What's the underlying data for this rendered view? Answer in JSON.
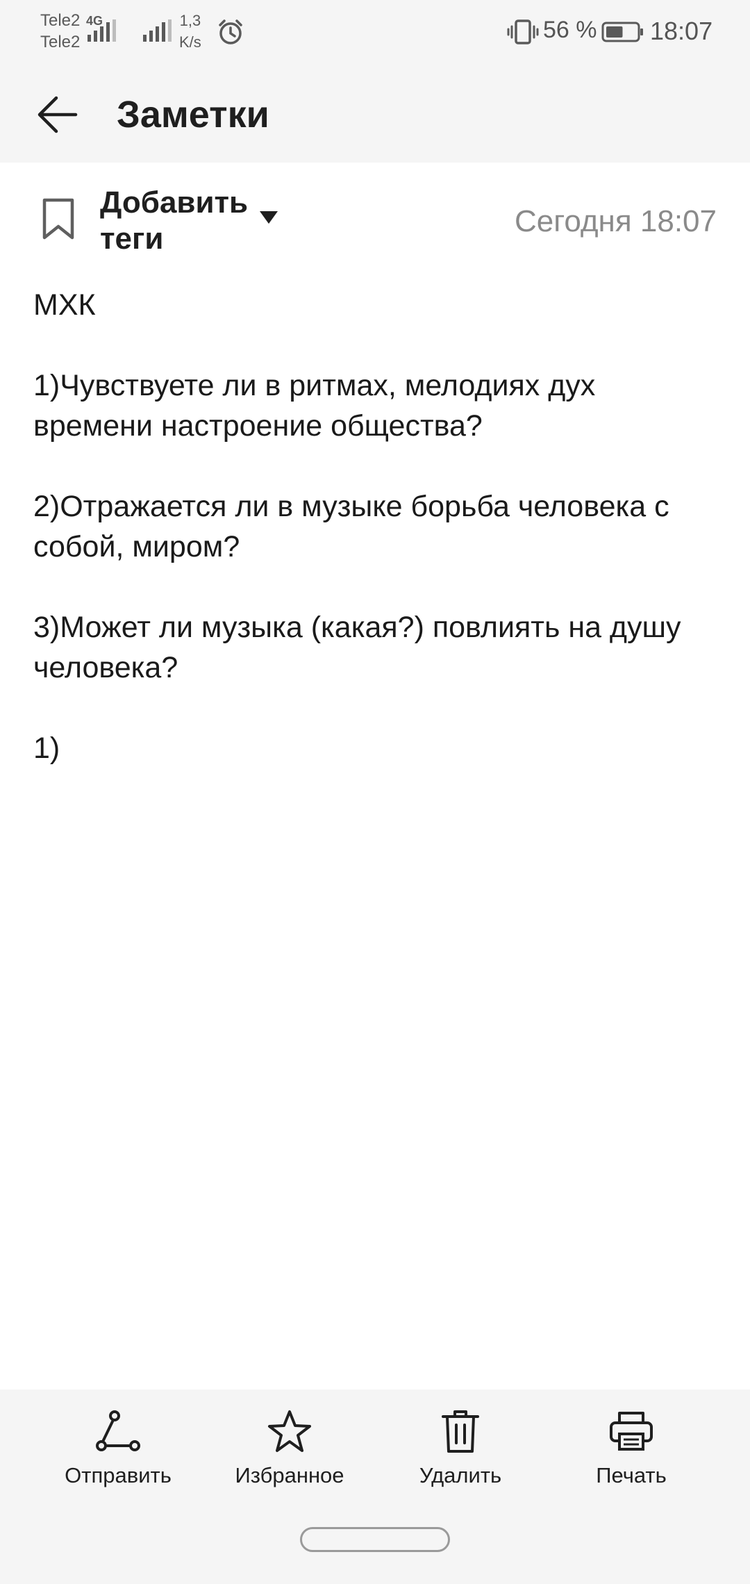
{
  "status_bar": {
    "carrier_1": "Tele2",
    "carrier_2": "Tele2",
    "network_type": "4G",
    "speed_value": "1,3",
    "speed_unit": "K/s",
    "battery_percent": "56 %",
    "time": "18:07",
    "battery_level": 0.56,
    "icons": [
      "signal-icon",
      "alarm-icon",
      "vibrate-icon",
      "battery-icon"
    ]
  },
  "app_bar": {
    "title": "Заметки",
    "back_icon": "arrow-left-icon"
  },
  "tag_row": {
    "label_line1": "Добавить",
    "label_line2": "теги",
    "date": "Сегодня 18:07",
    "icons": [
      "bookmark-icon",
      "dropdown-icon"
    ]
  },
  "note": {
    "title": "МХК",
    "lines": [
      "1)Чувствуете ли в ритмах, мелодиях дух времени настроение общества?",
      "2)Отражается ли в музыке борьба человека с собой, миром?",
      "3)Может ли музыка (какая?) повлиять на душу человека?",
      "1)"
    ]
  },
  "toolbar": {
    "send_label": "Отправить",
    "favorite_label": "Избранное",
    "delete_label": "Удалить",
    "print_label": "Печать",
    "icons": [
      "share-icon",
      "star-icon",
      "trash-icon",
      "printer-icon"
    ]
  },
  "colors": {
    "bar_background": "#f5f5f5",
    "content_background": "#ffffff",
    "text_primary": "#1a1a1a",
    "text_secondary": "#8a8a8a"
  }
}
